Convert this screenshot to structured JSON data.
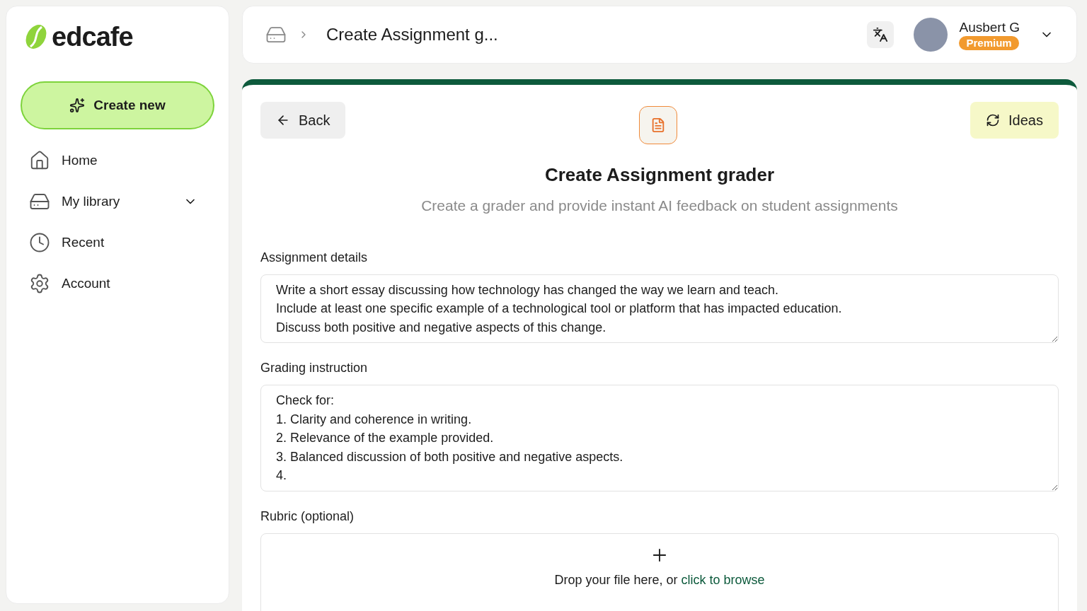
{
  "sidebar": {
    "logo": "edcafe",
    "create_button": "Create new",
    "items": [
      {
        "kind": "home",
        "label": "Home",
        "selected": false
      },
      {
        "kind": "library",
        "label": "My library",
        "selected": false,
        "expanded": false
      },
      {
        "kind": "recent",
        "label": "Recent",
        "selected": false
      },
      {
        "kind": "account",
        "label": "Account",
        "selected": false
      }
    ]
  },
  "header": {
    "breadcrumb": "Create Assignment g...",
    "user": {
      "name": "Ausbert G",
      "badge": "Premium"
    }
  },
  "page": {
    "back": "Back",
    "ideas": "Ideas",
    "title": "Create Assignment grader",
    "subtitle": "Create a grader and provide instant AI feedback on student assignments",
    "fields": [
      {
        "label": "Assignment details",
        "value": "Write a short essay discussing how technology has changed the way we learn and teach.\nInclude at least one specific example of a technological tool or platform that has impacted education.\nDiscuss both positive and negative aspects of this change."
      },
      {
        "label": "Grading instruction",
        "value": "Check for:\n1. Clarity and coherence in writing.\n2. Relevance of the example provided.\n3. Balanced discussion of both positive and negative aspects.\n4."
      }
    ],
    "rubric": {
      "label": "Rubric (optional)",
      "drop_text": "Drop your file here, or ",
      "browse_link": "click to browse"
    }
  }
}
